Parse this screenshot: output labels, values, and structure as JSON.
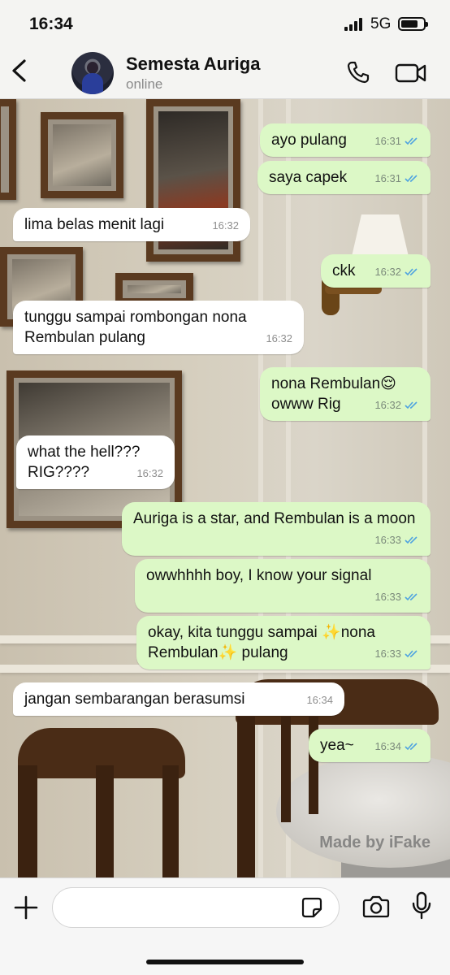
{
  "status_bar": {
    "time": "16:34",
    "network": "5G"
  },
  "header": {
    "contact_name": "Semesta Auriga",
    "contact_status": "online"
  },
  "messages": [
    {
      "text": "ayo pulang",
      "time": "16:31"
    },
    {
      "text": "saya capek",
      "time": "16:31"
    },
    {
      "text": "lima belas menit lagi",
      "time": "16:32"
    },
    {
      "text": "ckk",
      "time": "16:32"
    },
    {
      "text": "tunggu sampai rombongan nona Rembulan pulang",
      "time": "16:32"
    },
    {
      "text": "nona Rembulan😌 owww Rig",
      "time": "16:32"
    },
    {
      "text": "what the hell??? RIG????",
      "time": "16:32"
    },
    {
      "text": "Auriga is a star, and Rembulan is a moon",
      "time": "16:33"
    },
    {
      "text": "owwhhhh boy, I know your signal",
      "time": "16:33"
    },
    {
      "text": "okay, kita tunggu sampai ✨nona Rembulan✨ pulang",
      "time": "16:33"
    },
    {
      "text": "jangan sembarangan berasumsi",
      "time": "16:34"
    },
    {
      "text": "yea~",
      "time": "16:34"
    }
  ],
  "watermark": "Made by iFake",
  "colors": {
    "outgoing_bubble": "#dcf8c6",
    "incoming_bubble": "#ffffff",
    "read_ticks": "#4fa3e0"
  }
}
